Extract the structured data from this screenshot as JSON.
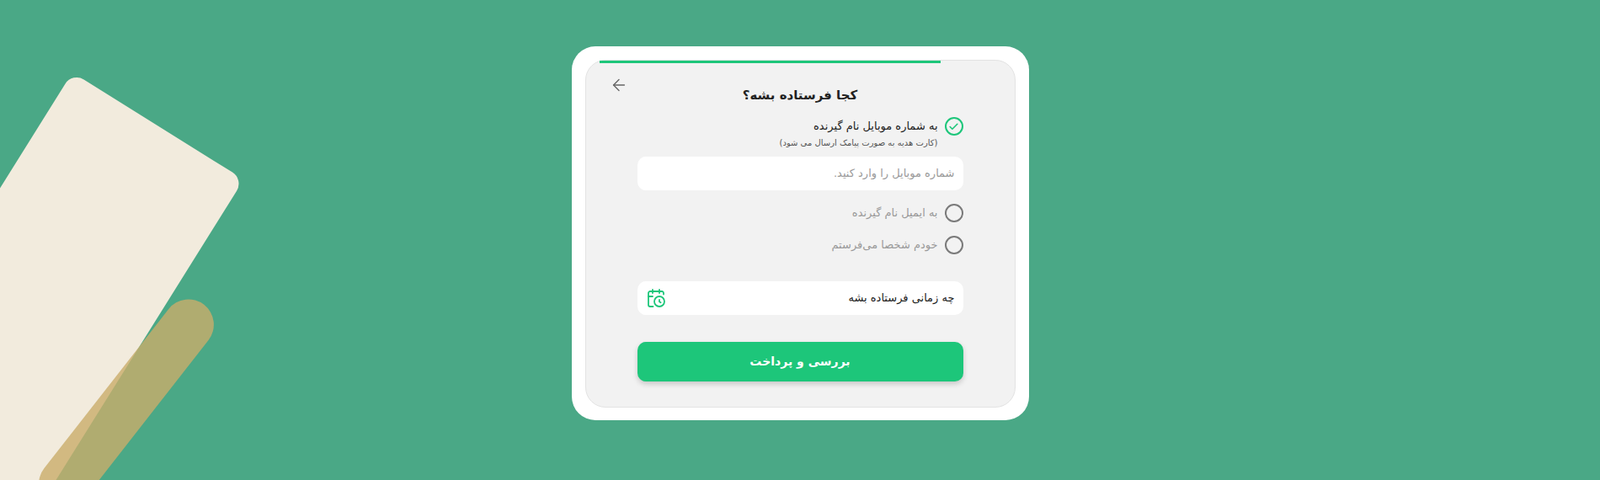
{
  "progress": {
    "level": 0.85
  },
  "title": "کجا فرستاده بشه؟",
  "options": [
    {
      "label": "به شماره موبایل نام گیرنده",
      "note": "(کارت هدیه به صورت پیامک ارسال می شود)",
      "placeholder": "شماره موبایل را وارد کنید.",
      "selected": true
    },
    {
      "label": "به ایمیل نام گیرنده",
      "selected": false
    },
    {
      "label": "خودم شخصا می‌فرستم",
      "selected": false
    }
  ],
  "schedule": {
    "label": "چه زمانی فرستاده بشه"
  },
  "submit": {
    "label": "بررسی و پرداخت"
  }
}
